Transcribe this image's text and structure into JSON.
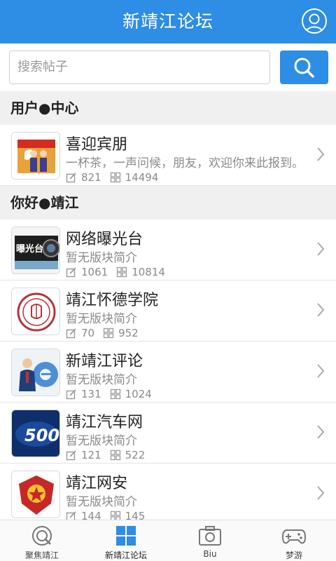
{
  "header": {
    "title": "新靖江论坛"
  },
  "search": {
    "placeholder": "搜索帖子"
  },
  "sections": [
    {
      "title": "用户●中心"
    },
    {
      "title": "你好●靖江"
    }
  ],
  "forums": [
    {
      "name": "喜迎宾朋",
      "desc": "一杯茶，一声问候，朋友，欢迎你来此报到。",
      "posts": "821",
      "threads": "14494",
      "icon": "welcome-icon"
    },
    {
      "name": "网络曝光台",
      "desc": "暂无版块简介",
      "posts": "1061",
      "threads": "10814",
      "icon": "camera-exposure-icon",
      "thumb_text": "曝光台"
    },
    {
      "name": "靖江怀德学院",
      "desc": "暂无版块简介",
      "posts": "70",
      "threads": "952",
      "icon": "college-seal-icon"
    },
    {
      "name": "新靖江评论",
      "desc": "暂无版块简介",
      "posts": "131",
      "threads": "1024",
      "icon": "ie-commentator-icon"
    },
    {
      "name": "靖江汽车网",
      "desc": "暂无版块简介",
      "posts": "121",
      "threads": "522",
      "icon": "car-500-icon",
      "thumb_text": "500"
    },
    {
      "name": "靖江网安",
      "desc": "暂无版块简介",
      "posts": "144",
      "threads": "145",
      "icon": "police-emblem-icon"
    }
  ],
  "bottom_nav": [
    {
      "label": "聚焦靖江",
      "icon": "focus-icon"
    },
    {
      "label": "新靖江论坛",
      "icon": "grid-icon",
      "active": true
    },
    {
      "label": "Biu",
      "icon": "camera-icon"
    },
    {
      "label": "梦游",
      "icon": "gamepad-icon"
    }
  ],
  "colors": {
    "primary": "#2e8de4",
    "section_bg": "#f0f0f0",
    "muted_text": "#8a8a8a"
  }
}
